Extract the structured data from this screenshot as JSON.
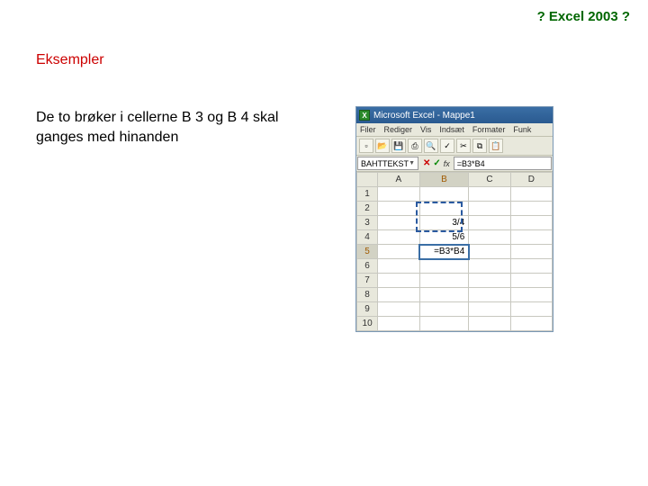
{
  "header": {
    "title": "? Excel 2003 ?"
  },
  "subtitle": "Eksempler",
  "body": "De to brøker i cellerne B 3 og B 4 skal ganges med hinanden",
  "excel": {
    "app_title": "Microsoft Excel - Mappe1",
    "menu": [
      "Filer",
      "Rediger",
      "Vis",
      "Indsæt",
      "Formater",
      "Funk"
    ],
    "name_box": "BAHTTEKST",
    "formula": "=B3*B4",
    "columns": [
      "A",
      "B",
      "C",
      "D"
    ],
    "rows": [
      "1",
      "2",
      "3",
      "4",
      "5",
      "6",
      "7",
      "8",
      "9",
      "10"
    ],
    "cells": {
      "B3": "3/4",
      "B4": "5/6",
      "B5": "=B3*B4"
    },
    "active_row": "5",
    "active_col": "B"
  }
}
